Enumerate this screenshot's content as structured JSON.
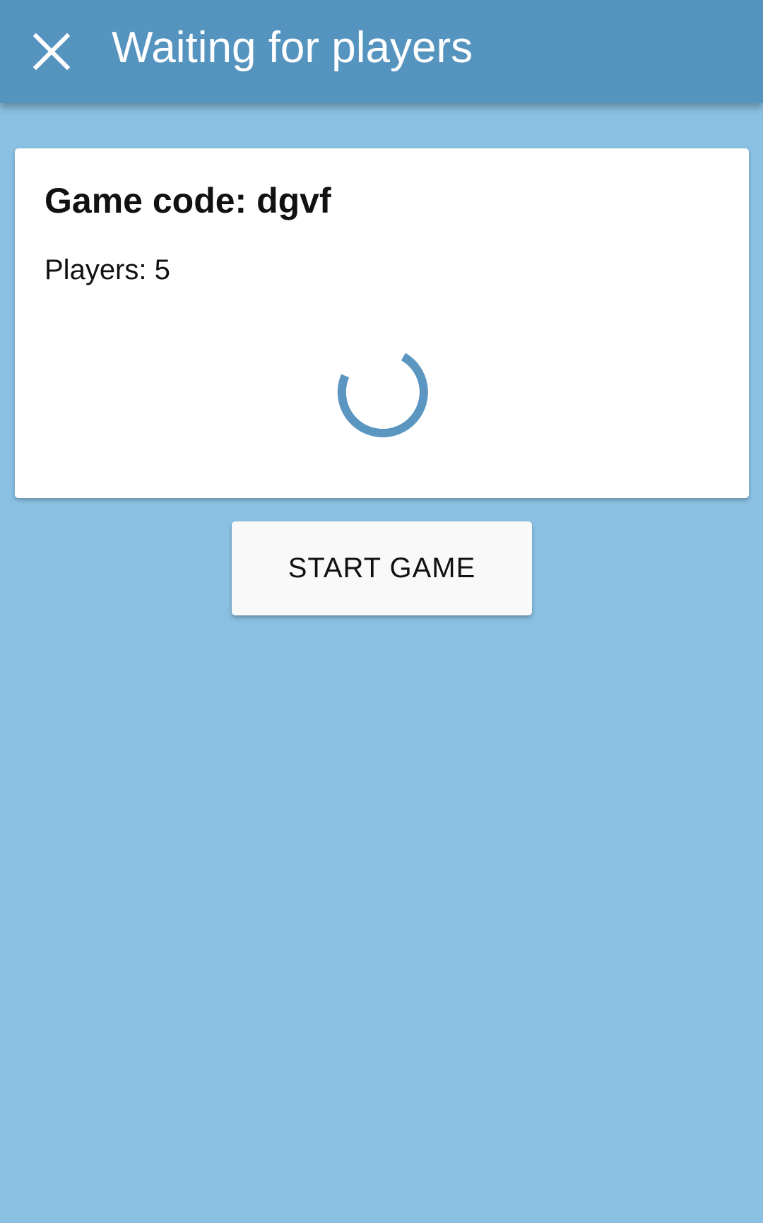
{
  "app_bar": {
    "title": "Waiting for players",
    "close_icon": "close-icon",
    "background_color": "#5694c0"
  },
  "card": {
    "game_code": "Game code: dgvf",
    "players": "Players: 5",
    "spinner_icon": "loading-spinner-icon",
    "spinner_color": "#5b96c1"
  },
  "actions": {
    "start_label": "START GAME"
  },
  "page": {
    "background_color": "#8ac0e2"
  }
}
